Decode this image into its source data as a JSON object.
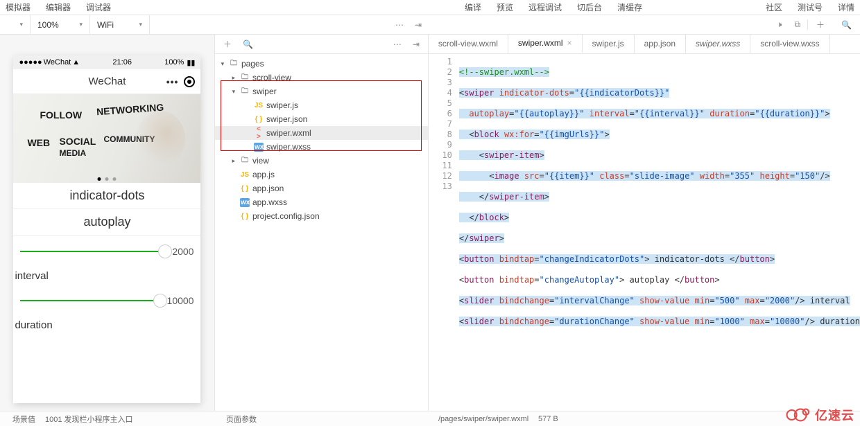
{
  "menus": {
    "left": [
      "模拟器",
      "编辑器",
      "调试器"
    ],
    "center": [
      "编译",
      "预览",
      "远程调试",
      "切后台",
      "清缓存"
    ],
    "right": [
      "社区",
      "测试号",
      "详情"
    ]
  },
  "toolbar": {
    "zoom": "100%",
    "network": "WiFi"
  },
  "sim": {
    "carrier": "WeChat",
    "time": "21:06",
    "battery": "100%",
    "title": "WeChat",
    "keywords": {
      "follow": "FOLLOW",
      "web": "WEB",
      "social": "SOCIAL",
      "media": "MEDIA",
      "network": "NETWORKING",
      "community": "COMMUNITY"
    },
    "btn_indicator": "indicator-dots",
    "btn_autoplay": "autoplay",
    "slider1_val": "2000",
    "label_interval": "interval",
    "slider2_val": "10000",
    "label_duration": "duration"
  },
  "tree": {
    "pages": "pages",
    "scrollview": "scroll-view",
    "swiper": "swiper",
    "swiper_js": "swiper.js",
    "swiper_json": "swiper.json",
    "swiper_wxml": "swiper.wxml",
    "swiper_wxss": "swiper.wxss",
    "view": "view",
    "app_js": "app.js",
    "app_json": "app.json",
    "app_wxss": "app.wxss",
    "proj": "project.config.json"
  },
  "tabs": {
    "t1": "scroll-view.wxml",
    "t2": "swiper.wxml",
    "t3": "swiper.js",
    "t4": "app.json",
    "t5": "swiper.wxss",
    "t6": "scroll-view.wxss"
  },
  "lines": [
    "1",
    "2",
    "3",
    "4",
    "5",
    "6",
    "7",
    "8",
    "9",
    "10",
    "11",
    "12",
    "13"
  ],
  "code": {
    "l1": {
      "a": "<!--swiper.wxml-->"
    },
    "l2": {
      "a": "<",
      "b": "swiper ",
      "c": "indicator-dots",
      "d": "=",
      "e": "\"{{indicatorDots}}\"",
      "f": ""
    },
    "l3": {
      "a": "  ",
      "b": "autoplay",
      "c": "=",
      "d": "\"{{autoplay}}\"",
      "e": " ",
      "f": "interval",
      "g": "=",
      "h": "\"{{interval}}\"",
      "i": " ",
      "j": "duration",
      "k": "=",
      "l": "\"{{duration}}\"",
      "m": ">"
    },
    "l4": {
      "a": "  <",
      "b": "block ",
      "c": "wx:for",
      "d": "=",
      "e": "\"{{imgUrls}}\"",
      "f": ">"
    },
    "l5": {
      "a": "    <",
      "b": "swiper-item",
      "c": ">"
    },
    "l6": {
      "a": "      <",
      "b": "image ",
      "c": "src",
      "d": "=",
      "e": "\"{{item}}\"",
      "f": " ",
      "g": "class",
      "h": "=",
      "i": "\"slide-image\"",
      "j": " ",
      "k": "width",
      "l": "=",
      "m": "\"355\"",
      "n": " ",
      "o": "height",
      "p": "=",
      "q": "\"150\"",
      "r": "/>"
    },
    "l7": {
      "a": "    </",
      "b": "swiper-item",
      "c": ">"
    },
    "l8": {
      "a": "  </",
      "b": "block",
      "c": ">"
    },
    "l9": {
      "a": "</",
      "b": "swiper",
      "c": ">"
    },
    "l10": {
      "a": "<",
      "b": "button ",
      "c": "bindtap",
      "d": "=",
      "e": "\"changeIndicatorDots\"",
      "f": "> indicator-dots </",
      "g": "button",
      "h": ">"
    },
    "l11": {
      "a": "<",
      "b": "button ",
      "c": "bindtap",
      "d": "=",
      "e": "\"changeAutoplay\"",
      "f": "> autoplay </",
      "g": "button",
      "h": ">"
    },
    "l12": {
      "a": "<",
      "b": "slider ",
      "c": "bindchange",
      "d": "=",
      "e": "\"intervalChange\"",
      "f": " ",
      "g": "show-value ",
      "h": "min",
      "i": "=",
      "j": "\"500\"",
      "k": " ",
      "l": "max",
      "m": "=",
      "n": "\"2000\"",
      "o": "/> interval"
    },
    "l13": {
      "a": "<",
      "b": "slider ",
      "c": "bindchange",
      "d": "=",
      "e": "\"durationChange\"",
      "f": " ",
      "g": "show-value ",
      "h": "min",
      "i": "=",
      "j": "\"1000\"",
      "k": " ",
      "l": "max",
      "m": "=",
      "n": "\"10000\"",
      "o": "/> duration"
    }
  },
  "footer": {
    "scene_label": "场景值",
    "scene": "1001 发现栏小程序主入口",
    "params": "页面参数",
    "path": "/pages/swiper/swiper.wxml",
    "size": "577 B"
  },
  "watermark": "亿速云"
}
